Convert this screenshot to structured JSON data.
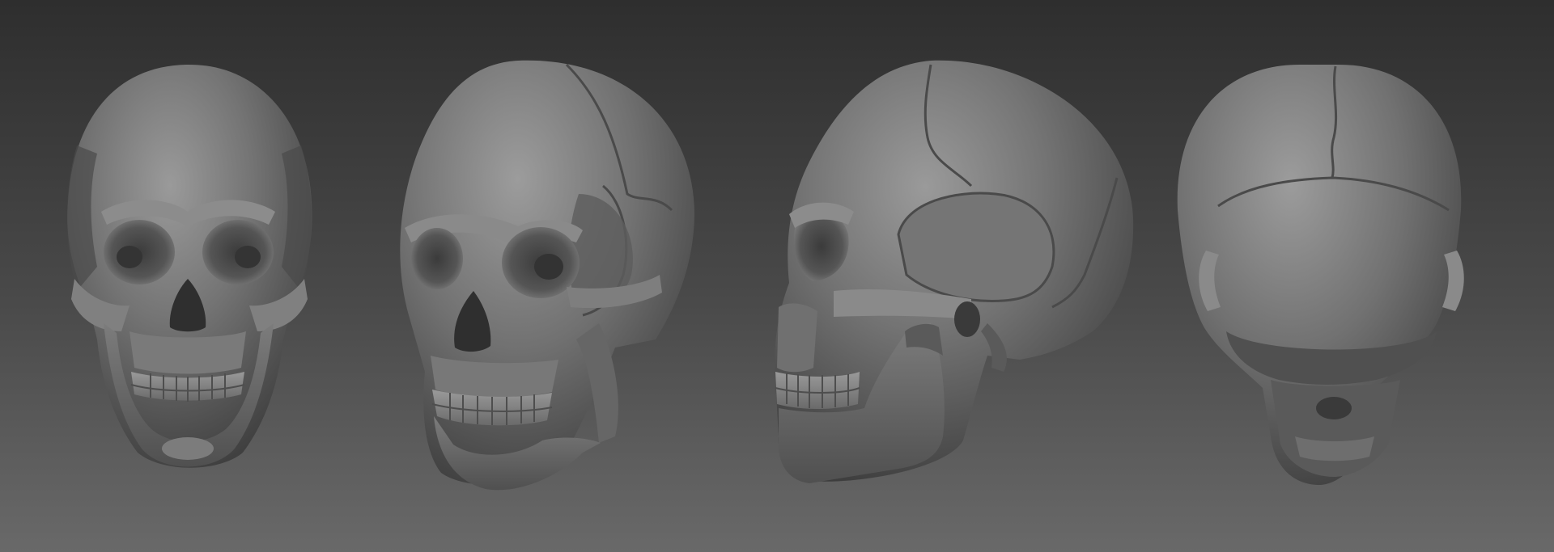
{
  "scene": {
    "background_top": "#2e2e2e",
    "background_bottom": "#696969",
    "material_color": "#6e6e6e",
    "views": [
      {
        "name": "front-view"
      },
      {
        "name": "three-quarter-view"
      },
      {
        "name": "side-view"
      },
      {
        "name": "top-back-view"
      }
    ]
  }
}
